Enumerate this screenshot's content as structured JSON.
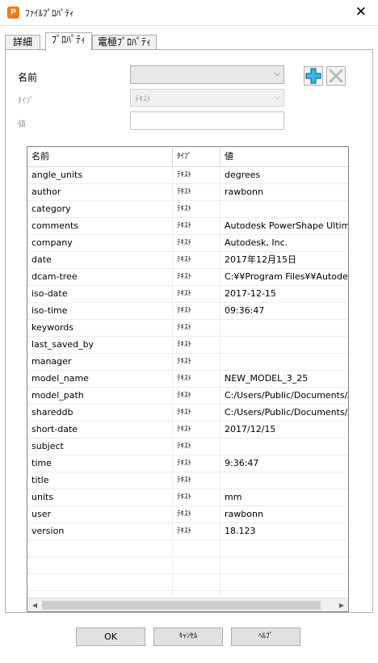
{
  "window": {
    "app_icon_letter": "P",
    "title": "ﾌｧｲﾙﾌﾟﾛﾊﾟﾃｨ",
    "close_glyph": "✕"
  },
  "tabs": [
    {
      "label": "詳細"
    },
    {
      "label": "ﾌﾟﾛﾊﾟﾃｨ"
    },
    {
      "label": "電極ﾌﾟﾛﾊﾟﾃｨ"
    }
  ],
  "form": {
    "name_label": "名前",
    "name_value": "",
    "type_label": "ﾀｲﾌﾟ",
    "type_value": "ﾃｷｽﾄ",
    "value_label": "値",
    "value_value": "",
    "dropdown_glyph": "⌵"
  },
  "grid": {
    "columns": [
      "名前",
      "ﾀｲﾌﾟ",
      "値"
    ],
    "rows": [
      {
        "name": "angle_units",
        "type": "ﾃｷｽﾄ",
        "value": "degrees"
      },
      {
        "name": "author",
        "type": "ﾃｷｽﾄ",
        "value": "rawbonn"
      },
      {
        "name": "category",
        "type": "ﾃｷｽﾄ",
        "value": ""
      },
      {
        "name": "comments",
        "type": "ﾃｷｽﾄ",
        "value": "Autodesk PowerShape Ultima"
      },
      {
        "name": "company",
        "type": "ﾃｷｽﾄ",
        "value": "Autodesk, Inc."
      },
      {
        "name": "date",
        "type": "ﾃｷｽﾄ",
        "value": "2017年12月15日"
      },
      {
        "name": "dcam-tree",
        "type": "ﾃｷｽﾄ",
        "value": "C:¥¥Program Files¥¥Autodesk"
      },
      {
        "name": "iso-date",
        "type": "ﾃｷｽﾄ",
        "value": "2017-12-15"
      },
      {
        "name": "iso-time",
        "type": "ﾃｷｽﾄ",
        "value": "09:36:47"
      },
      {
        "name": "keywords",
        "type": "ﾃｷｽﾄ",
        "value": ""
      },
      {
        "name": "last_saved_by",
        "type": "ﾃｷｽﾄ",
        "value": ""
      },
      {
        "name": "manager",
        "type": "ﾃｷｽﾄ",
        "value": ""
      },
      {
        "name": "model_name",
        "type": "ﾃｷｽﾄ",
        "value": "NEW_MODEL_3_25"
      },
      {
        "name": "model_path",
        "type": "ﾃｷｽﾄ",
        "value": "C:/Users/Public/Documents/A"
      },
      {
        "name": "shareddb",
        "type": "ﾃｷｽﾄ",
        "value": "C:/Users/Public/Documents/A"
      },
      {
        "name": "short-date",
        "type": "ﾃｷｽﾄ",
        "value": "2017/12/15"
      },
      {
        "name": "subject",
        "type": "ﾃｷｽﾄ",
        "value": ""
      },
      {
        "name": "time",
        "type": "ﾃｷｽﾄ",
        "value": "9:36:47"
      },
      {
        "name": "title",
        "type": "ﾃｷｽﾄ",
        "value": ""
      },
      {
        "name": "units",
        "type": "ﾃｷｽﾄ",
        "value": "mm"
      },
      {
        "name": "user",
        "type": "ﾃｷｽﾄ",
        "value": "rawbonn"
      },
      {
        "name": "version",
        "type": "ﾃｷｽﾄ",
        "value": "18.123"
      }
    ],
    "scroll_left_glyph": "◀",
    "scroll_right_glyph": "▶"
  },
  "buttons": {
    "ok": "OK",
    "cancel": "ｷｬﾝｾﾙ",
    "help": "ﾍﾙﾌﾟ"
  },
  "colors": {
    "app_icon": "#f07a1a",
    "add_icon": "#39b7e6",
    "delete_icon_disabled": "#b9b9b9"
  }
}
